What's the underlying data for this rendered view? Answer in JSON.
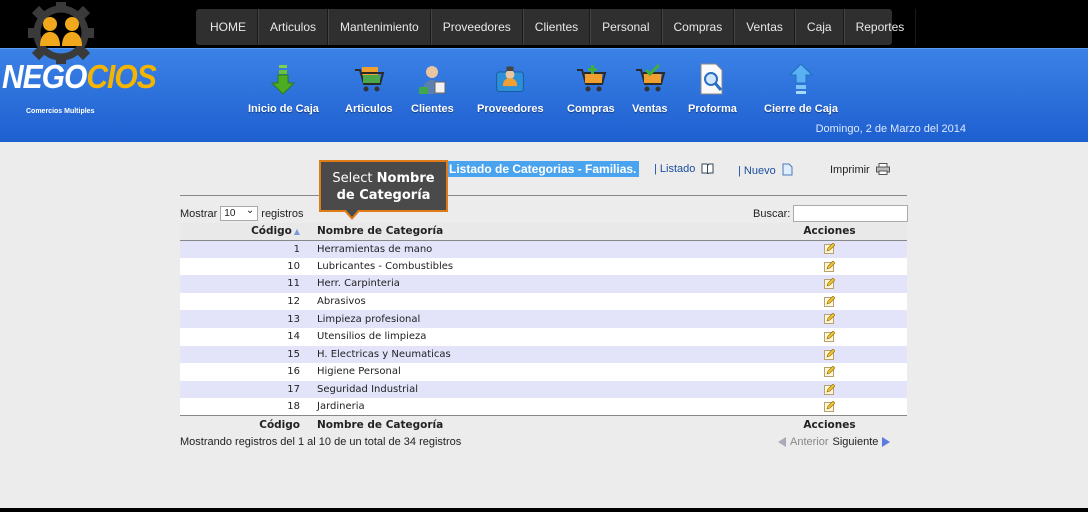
{
  "menu": [
    "HOME",
    "Articulos",
    "Mantenimiento",
    "Proveedores",
    "Clientes",
    "Personal",
    "Compras",
    "Ventas",
    "Caja",
    "Reportes"
  ],
  "logo": {
    "text_main": "NEGO",
    "text_accent": "CIOS",
    "subtitle": "Comercios Multiples"
  },
  "toolbar": [
    {
      "label": "Inicio de Caja",
      "icon": "green-down-arrow-icon"
    },
    {
      "label": "Articulos",
      "icon": "shopping-cart-icon"
    },
    {
      "label": "Clientes",
      "icon": "customer-person-icon"
    },
    {
      "label": "Proveedores",
      "icon": "supplier-person-icon"
    },
    {
      "label": "Compras",
      "icon": "cart-add-icon"
    },
    {
      "label": "Ventas",
      "icon": "cart-check-icon"
    },
    {
      "label": "Proforma",
      "icon": "document-search-icon"
    },
    {
      "label": "Cierre de Caja",
      "icon": "blue-up-arrow-icon"
    }
  ],
  "date": "Domingo, 2 de Marzo del 2014",
  "page": {
    "heading": "Listado de Categorias - Familias.",
    "link_listado": "Listado",
    "link_nuevo": "Nuevo",
    "print_label": "Imprimir",
    "separator": "|"
  },
  "tooltip": {
    "line1_prefix": "Select ",
    "line1_bold": "Nombre",
    "line2_bold": "de Categoría"
  },
  "table_controls": {
    "show_prefix": "Mostrar",
    "page_size": "10",
    "show_suffix": "registros",
    "search_label": "Buscar:"
  },
  "table": {
    "columns": [
      "Código",
      "Nombre de Categoría",
      "Acciones"
    ],
    "rows": [
      {
        "code": "1",
        "name": "Herramientas de mano"
      },
      {
        "code": "10",
        "name": "Lubricantes - Combustibles"
      },
      {
        "code": "11",
        "name": "Herr. Carpinteria"
      },
      {
        "code": "12",
        "name": "Abrasivos"
      },
      {
        "code": "13",
        "name": "Limpieza profesional"
      },
      {
        "code": "14",
        "name": "Utensilios de limpieza"
      },
      {
        "code": "15",
        "name": "H. Electricas y Neumaticas"
      },
      {
        "code": "16",
        "name": "Higiene Personal"
      },
      {
        "code": "17",
        "name": "Seguridad Industrial"
      },
      {
        "code": "18",
        "name": "Jardineria"
      }
    ]
  },
  "footer": {
    "info": "Mostrando registros del 1 al 10 de un total de 34 registros",
    "prev": "Anterior",
    "next": "Siguiente"
  }
}
